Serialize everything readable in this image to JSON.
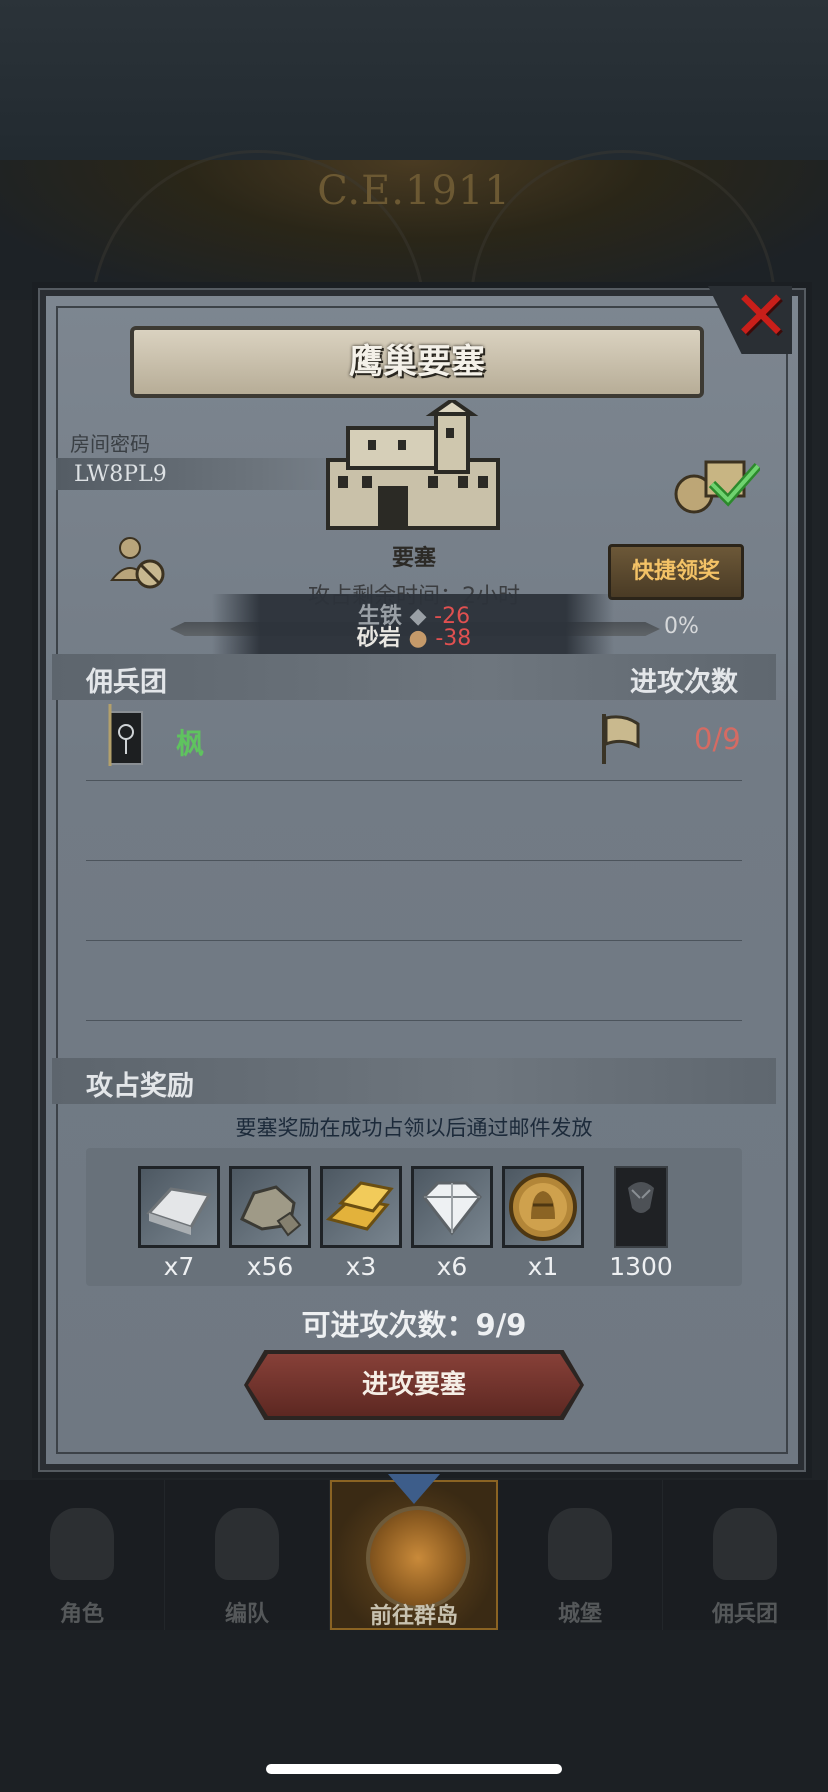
{
  "header": {
    "year": "C.E.1911"
  },
  "dialog": {
    "title": "鹰巢要塞",
    "room_label": "房间密码",
    "room_code": "LW8PL9",
    "castle_name": "要塞",
    "claim_button": "快捷领奖",
    "attack_time": "攻占剩余时间：2小时",
    "resources": [
      {
        "name": "生铁",
        "value": "-26",
        "icon": "ingot-icon"
      },
      {
        "name": "砂岩",
        "value": "-38",
        "icon": "rock-icon"
      }
    ],
    "progress_percent": "0%",
    "progress_value": 0,
    "mercenary_header": "佣兵团",
    "attack_count_header": "进攻次数",
    "mercenary": {
      "name": "枫",
      "attack_count": "0/9"
    },
    "reward_header": "攻占奖励",
    "reward_note": "要塞奖励在成功占领以后通过邮件发放",
    "rewards": [
      {
        "icon": "silver-ingot-icon",
        "qty": "x7"
      },
      {
        "icon": "stone-icon",
        "qty": "x56"
      },
      {
        "icon": "gold-bar-icon",
        "qty": "x3"
      },
      {
        "icon": "diamond-icon",
        "qty": "x6"
      },
      {
        "icon": "knight-medal-icon",
        "qty": "x1"
      },
      {
        "icon": "banner-icon",
        "qty": "1300"
      }
    ],
    "attacks_available": "可进攻次数：9/9",
    "attack_button": "进攻要塞"
  },
  "nav": {
    "items": [
      {
        "label": "角色"
      },
      {
        "label": "编队"
      },
      {
        "label": "前往群岛",
        "active": true
      },
      {
        "label": "城堡"
      },
      {
        "label": "佣兵团"
      }
    ]
  },
  "colors": {
    "panel": "#727b85",
    "accent_gold": "#f3c266",
    "attack_red": "#d56b63",
    "merc_green": "#5fc35f",
    "button_red": "#874038"
  }
}
